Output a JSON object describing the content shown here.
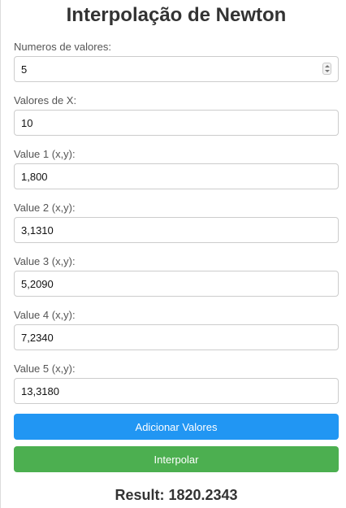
{
  "title": "Interpolação de Newton",
  "num_values": {
    "label": "Numeros de valores:",
    "value": "5"
  },
  "x_values": {
    "label": "Valores de X:",
    "value": "10"
  },
  "points": [
    {
      "label": "Value 1 (x,y):",
      "value": "1,800"
    },
    {
      "label": "Value 2 (x,y):",
      "value": "3,1310"
    },
    {
      "label": "Value 3 (x,y):",
      "value": "5,2090"
    },
    {
      "label": "Value 4 (x,y):",
      "value": "7,2340"
    },
    {
      "label": "Value 5 (x,y):",
      "value": "13,3180"
    }
  ],
  "buttons": {
    "add_label": "Adicionar Valores",
    "add_color": "#2196f3",
    "interpolate_label": "Interpolar",
    "interpolate_color": "#4caf50"
  },
  "result": "Result: 1820.2343"
}
